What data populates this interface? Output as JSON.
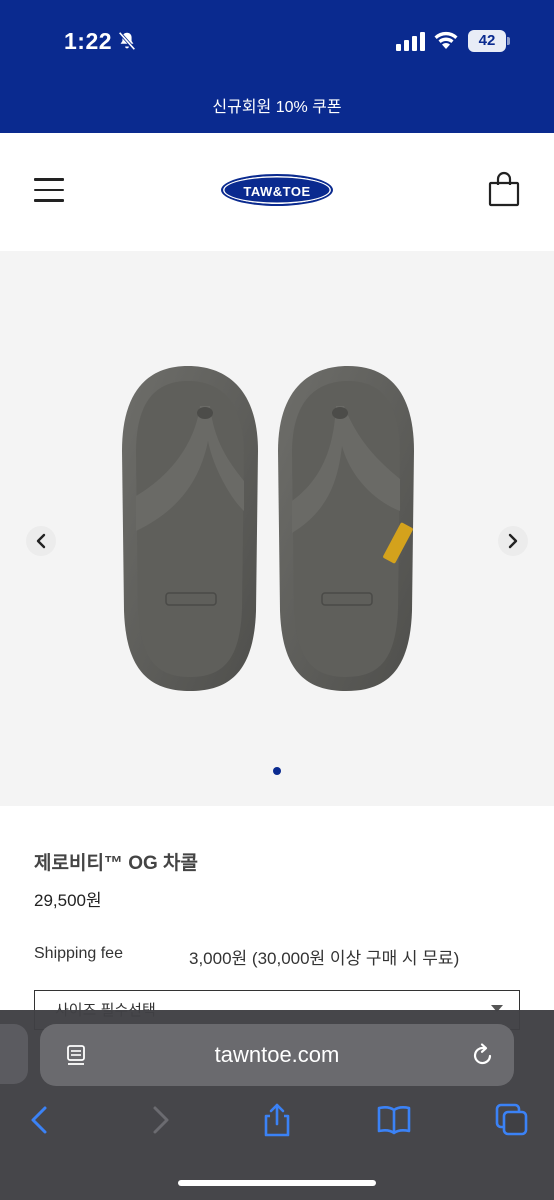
{
  "status_bar": {
    "time": "1:22",
    "battery": "42"
  },
  "promo": {
    "text": "신규회원 10% 쿠폰"
  },
  "header": {
    "logo_text": "TAW&TOE"
  },
  "gallery": {
    "slide_count": 1,
    "active_slide": 1
  },
  "product": {
    "name": "제로비티™ OG 차콜",
    "price": "29,500원",
    "shipping_label": "Shipping fee",
    "shipping_value": "3,000원 (30,000원 이상 구매 시 무료)",
    "size_select_text": "사이즈 필수선택"
  },
  "browser": {
    "url": "tawntoe.com"
  },
  "colors": {
    "brand": "#0a2a8f",
    "safari_bar": "#404044",
    "accent_blue": "#3b82f6"
  }
}
